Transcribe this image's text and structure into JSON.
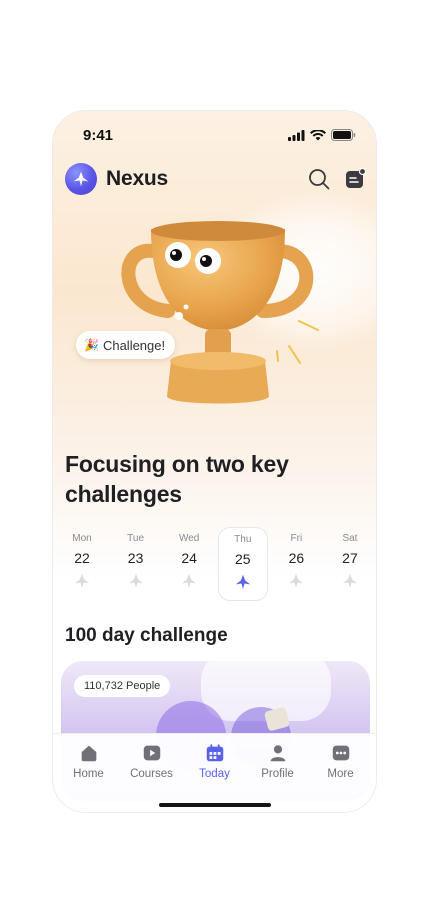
{
  "status_bar": {
    "time": "9:41"
  },
  "header": {
    "brand": "Nexus",
    "logo_icon": "nexus-logo-icon",
    "search_icon": "search-icon",
    "notes_icon": "notes-icon",
    "accent": "#5a55e6"
  },
  "hero": {
    "image": "trophy-mascot",
    "pill_label": "Challenge!",
    "pill_icon": "party-popper-icon"
  },
  "title": "Focusing on two key challenges",
  "days": [
    {
      "name": "Mon",
      "num": "22",
      "active": false
    },
    {
      "name": "Tue",
      "num": "23",
      "active": false
    },
    {
      "name": "Wed",
      "num": "24",
      "active": false
    },
    {
      "name": "Thu",
      "num": "25",
      "active": true
    },
    {
      "name": "Fri",
      "num": "26",
      "active": false
    },
    {
      "name": "Sat",
      "num": "27",
      "active": false
    }
  ],
  "section": {
    "title": "100 day challenge"
  },
  "card": {
    "people": "110,732 People"
  },
  "tabs": [
    {
      "label": "Home",
      "icon": "home-icon",
      "active": false
    },
    {
      "label": "Courses",
      "icon": "play-icon",
      "active": false
    },
    {
      "label": "Today",
      "icon": "calendar-icon",
      "active": true
    },
    {
      "label": "Profile",
      "icon": "profile-icon",
      "active": false
    },
    {
      "label": "More",
      "icon": "more-icon",
      "active": false
    }
  ],
  "colors": {
    "active_tab": "#5a62e8",
    "inactive_tab": "#707078",
    "background": "#fdf1e3"
  }
}
